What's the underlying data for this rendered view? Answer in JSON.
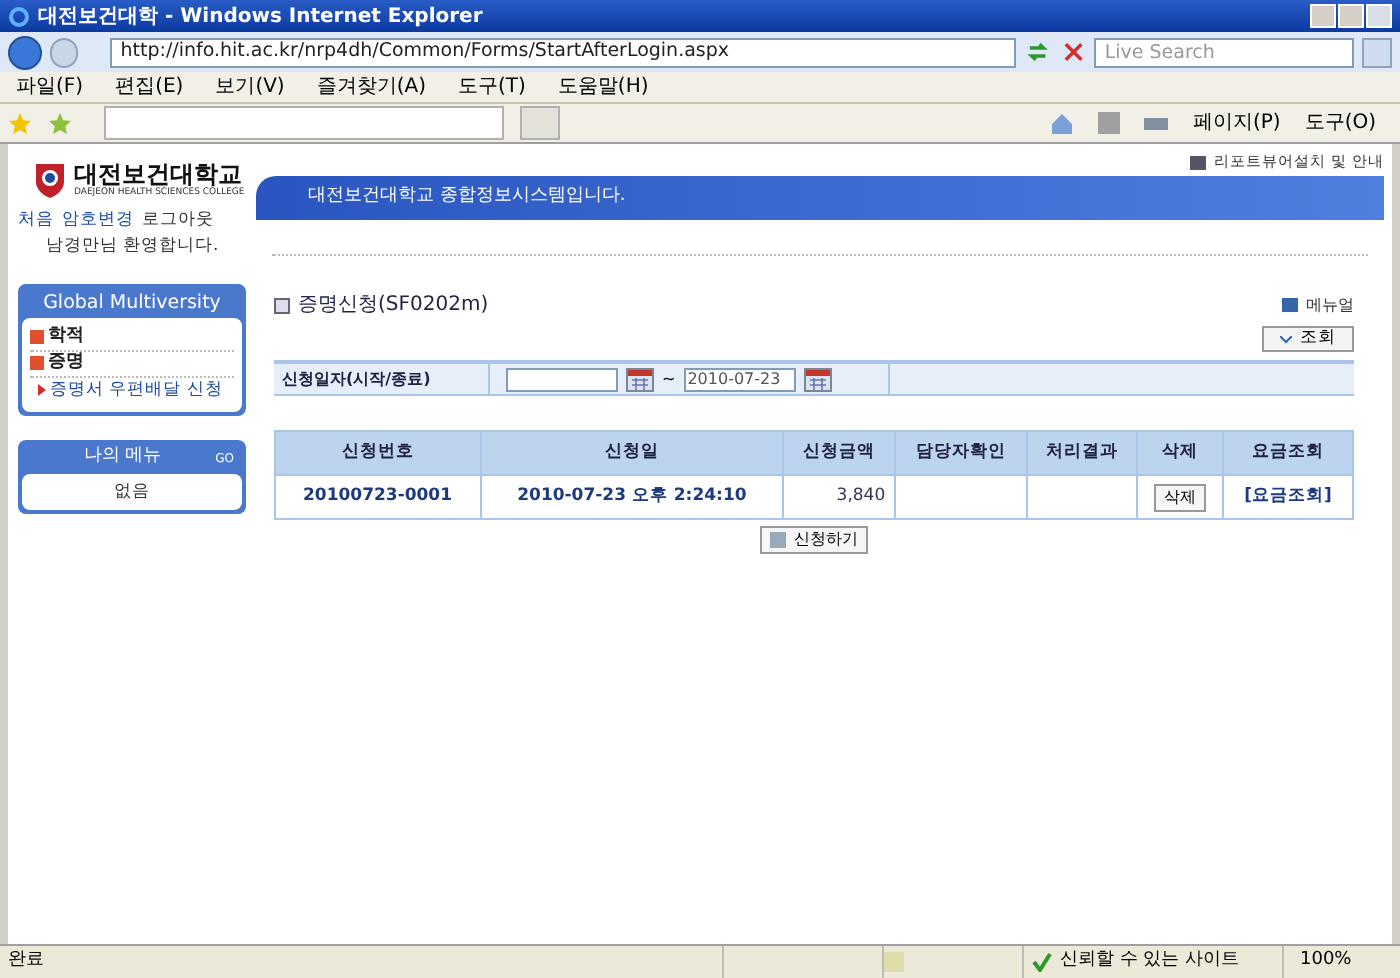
{
  "window": {
    "title": "대전보건대학 - Windows Internet Explorer"
  },
  "browser": {
    "address": "http://info.hit.ac.kr/nrp4dh/Common/Forms/StartAfterLogin.aspx",
    "search_placeholder": "Live Search",
    "menu": [
      "파일(F)",
      "편집(E)",
      "보기(V)",
      "즐겨찾기(A)",
      "도구(T)",
      "도움말(H)"
    ],
    "toolbar": [
      "페이지(P)",
      "도구(O)"
    ]
  },
  "header": {
    "logo_name": "대전보건대학교",
    "logo_sub": "DAEJEON HEALTH SCIENCES COLLEGE",
    "links": [
      "처음",
      "암호변경",
      "로그아웃"
    ],
    "welcome": "남경만님 환영합니다.",
    "banner": "대전보건대학교 종합정보시스템입니다.",
    "report_link": "리포트뷰어설치 및 안내"
  },
  "sidebar": {
    "title": "Global Multiversity",
    "items": [
      {
        "label": "학적"
      },
      {
        "label": "증명",
        "children": [
          {
            "label": "증명서 우편배달 신청"
          }
        ]
      }
    ],
    "my_menu": {
      "title": "나의 메뉴",
      "more": "GO",
      "items": [
        "없음"
      ]
    }
  },
  "main": {
    "title": "증명신청(SF0202m)",
    "manual": "메뉴얼",
    "search_button": "조회",
    "filter": {
      "label": "신청일자(시작/종료)",
      "separator": "~",
      "end": "2010-07-23"
    },
    "table": {
      "columns": [
        "신청번호",
        "신청일",
        "신청금액",
        "담당자확인",
        "처리결과",
        "삭제",
        "요금조회"
      ],
      "rows": [
        {
          "number": "20100723-0001",
          "date": "2010-07-23 오후 2:24:10",
          "amount": "3,840",
          "staff_check": "",
          "result": "",
          "delete": "삭제",
          "fee": "[요금조회]"
        }
      ]
    },
    "apply_button": "신청하기"
  },
  "status_bar": {
    "text": "완료",
    "zone": "신뢰할 수 있는 사이트",
    "zoom": "100%"
  }
}
